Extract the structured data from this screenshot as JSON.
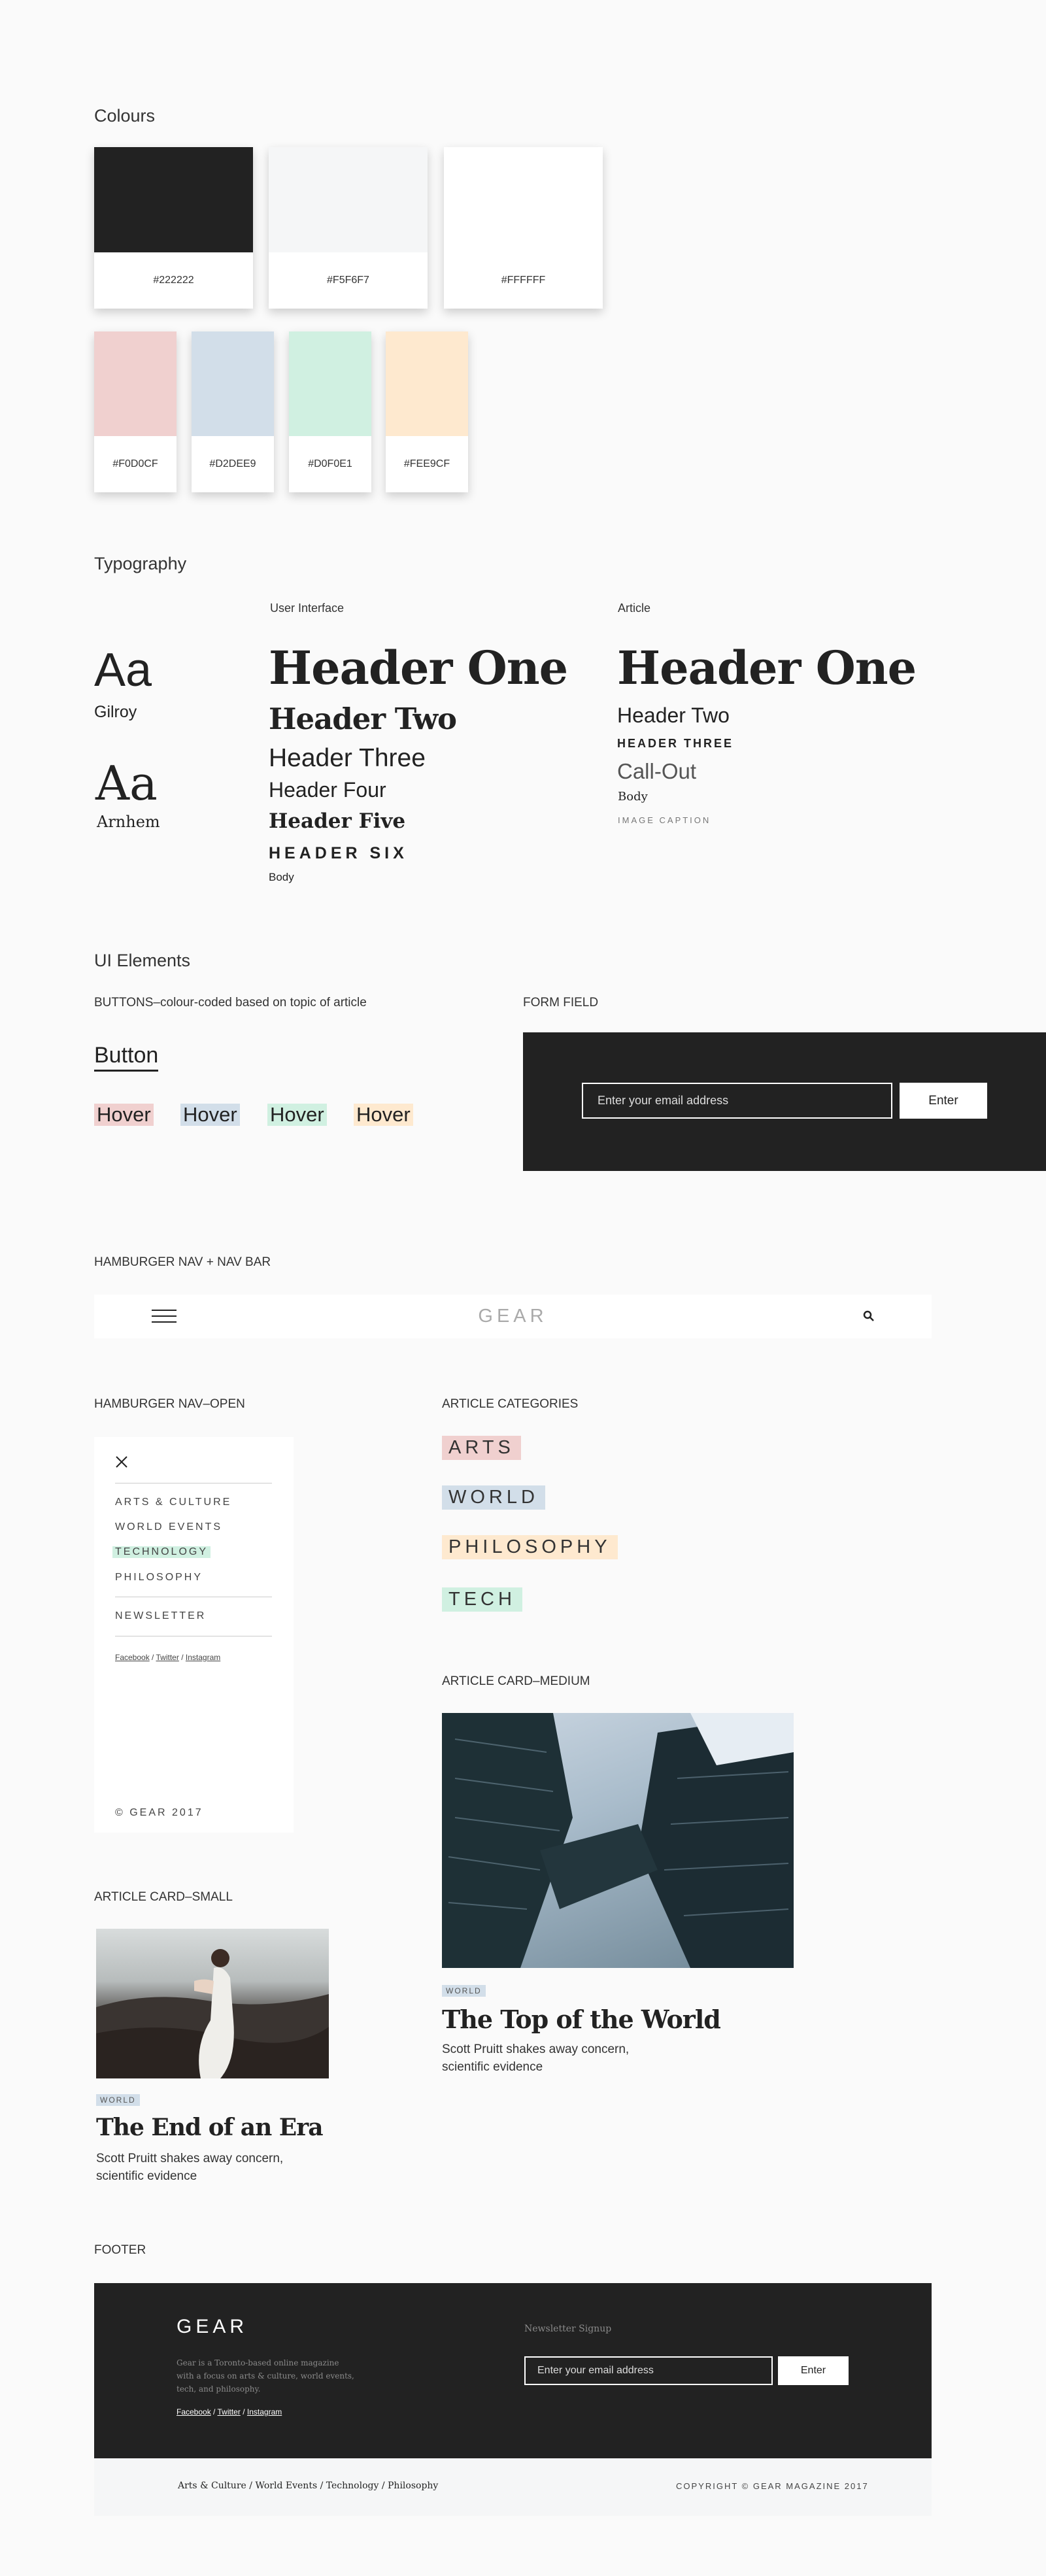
{
  "colours": {
    "title": "Colours",
    "primary": [
      {
        "hex": "#222222",
        "color": "#222222"
      },
      {
        "hex": "#F5F6F7",
        "color": "#F5F6F7"
      },
      {
        "hex": "#FFFFFF",
        "color": "#FFFFFF"
      }
    ],
    "accents": [
      {
        "hex": "#F0D0CF",
        "color": "#F0D0CF"
      },
      {
        "hex": "#D2DEE9",
        "color": "#D2DEE9"
      },
      {
        "hex": "#D0F0E1",
        "color": "#D0F0E1"
      },
      {
        "hex": "#FEE9CF",
        "color": "#FEE9CF"
      }
    ]
  },
  "typography": {
    "title": "Typography",
    "ui_label": "User Interface",
    "article_label": "Article",
    "sample": "Aa",
    "font1": "Gilroy",
    "font2": "Arnhem",
    "ui": {
      "h1": "Header One",
      "h2": "Header Two",
      "h3": "Header Three",
      "h4": "Header Four",
      "h5": "Header Five",
      "h6": "HEADER SIX",
      "body": "Body"
    },
    "article": {
      "h1": "Header One",
      "h2": "Header Two",
      "h3": "HEADER THREE",
      "callout": "Call-Out",
      "body": "Body",
      "caption": "IMAGE CAPTION"
    }
  },
  "ui_elements": {
    "title": "UI Elements",
    "buttons_label": "BUTTONS–colour-coded based on topic of article",
    "button": "Button",
    "hover": [
      "Hover",
      "Hover",
      "Hover",
      "Hover"
    ],
    "form_label": "FORM FIELD",
    "form_placeholder": "Enter your email address",
    "form_button": "Enter"
  },
  "navbar": {
    "label": "HAMBURGER NAV + NAV BAR",
    "logo": "GEAR"
  },
  "nav_open": {
    "label": "HAMBURGER NAV–OPEN",
    "items": [
      "ARTS & CULTURE",
      "WORLD EVENTS",
      "TECHNOLOGY",
      "PHILOSOPHY"
    ],
    "newsletter": "NEWSLETTER",
    "social": {
      "facebook": "Facebook",
      "twitter": "Twitter",
      "instagram": "Instagram",
      "sep": "/"
    },
    "copyright": "© GEAR 2017"
  },
  "categories": {
    "label": "ARTICLE CATEGORIES",
    "items": [
      "ARTS",
      "WORLD",
      "PHILOSOPHY",
      "TECH"
    ]
  },
  "card_medium": {
    "label": "ARTICLE CARD–MEDIUM",
    "tag": "WORLD",
    "title": "The Top of the World",
    "desc1": "Scott Pruitt shakes away concern,",
    "desc2": "scientific evidence"
  },
  "card_small": {
    "label": "ARTICLE CARD–SMALL",
    "tag": "WORLD",
    "title": "The End of an Era",
    "desc1": "Scott Pruitt shakes away concern,",
    "desc2": "scientific evidence"
  },
  "footer": {
    "label": "FOOTER",
    "logo": "GEAR",
    "about1": "Gear is a Toronto-based online magazine",
    "about2": "with a focus on arts & culture, world events,",
    "about3": "tech, and philosophy.",
    "social": {
      "facebook": "Facebook",
      "twitter": "Twitter",
      "instagram": "Instagram",
      "sep": "/"
    },
    "signup_label": "Newsletter Signup",
    "placeholder": "Enter your email address",
    "button": "Enter",
    "links": {
      "arts": "Arts & Culture",
      "world": "World Events",
      "tech": "Technology",
      "philosophy": "Philosophy",
      "sep": "/"
    },
    "copyright": "COPYRIGHT © GEAR MAGAZINE 2017"
  }
}
